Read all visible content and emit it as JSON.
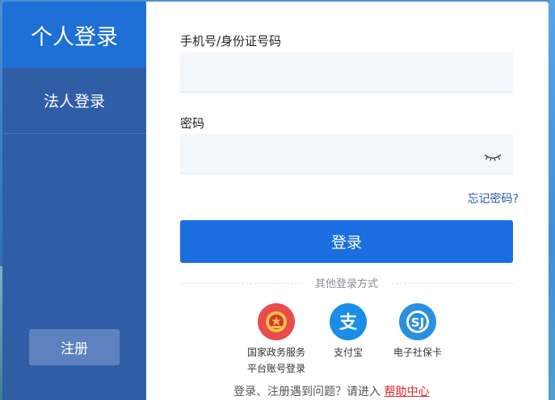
{
  "sidebar": {
    "tabs": [
      {
        "label": "个人登录",
        "active": true
      },
      {
        "label": "法人登录",
        "active": false
      }
    ],
    "register_label": "注册"
  },
  "form": {
    "phone_label": "手机号/身份证号码",
    "phone_value": "",
    "password_label": "密码",
    "password_value": "",
    "password_toggle_icon": "eye-closed-icon",
    "forgot_label": "忘记密码?",
    "login_label": "登录"
  },
  "other_methods": {
    "title": "其他登录方式",
    "items": [
      {
        "label_line1": "国家政务服务",
        "label_line2": "平台账号登录",
        "icon": "national-emblem-icon",
        "color": "#e84c4c"
      },
      {
        "label_line1": "支付宝",
        "label_line2": "",
        "icon": "alipay-icon",
        "color": "#1a8ee6"
      },
      {
        "label_line1": "电子社保卡",
        "label_line2": "",
        "icon": "social-security-card-icon",
        "color": "#2b8fe0"
      }
    ]
  },
  "help": {
    "text": "登录、注册遇到问题？请进入",
    "link_label": "帮助中心"
  },
  "colors": {
    "sidebar": "#2f5ea6",
    "active_tab": "#1e6fd6",
    "primary_button": "#1a6ee0",
    "help_link": "#e0232b"
  }
}
